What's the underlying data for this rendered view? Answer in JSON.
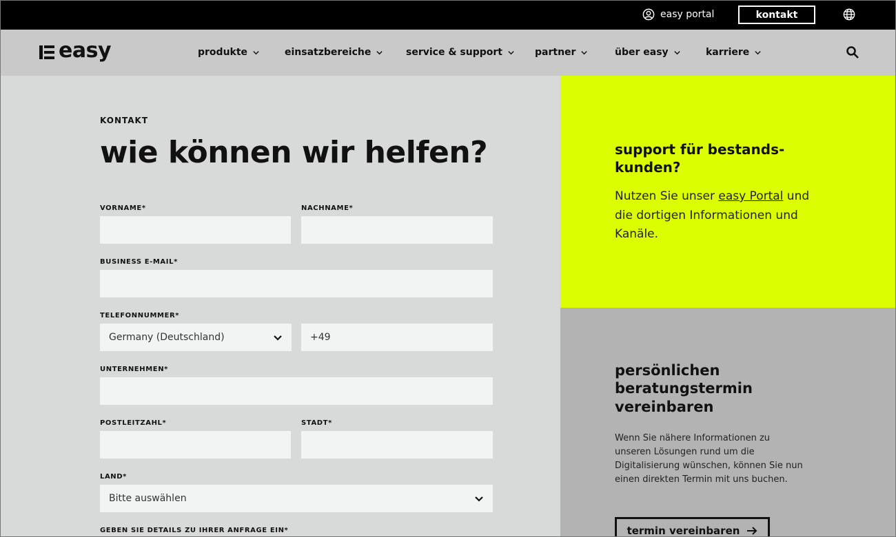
{
  "topbar": {
    "portal_label": "easy portal",
    "contact_label": "kontakt"
  },
  "nav": {
    "logo_text": "easy",
    "items": [
      {
        "label": "produkte"
      },
      {
        "label": "einsatzbereiche"
      },
      {
        "label": "service & support"
      },
      {
        "label": "partner"
      },
      {
        "label": "über easy"
      },
      {
        "label": "karriere"
      }
    ]
  },
  "form": {
    "eyebrow": "KONTAKT",
    "title": "wie können wir helfen?",
    "fields": {
      "vorname": {
        "label": "VORNAME*",
        "value": ""
      },
      "nachname": {
        "label": "NACHNAME*",
        "value": ""
      },
      "email": {
        "label": "BUSINESS E-MAIL*",
        "value": ""
      },
      "telefon": {
        "label": "TELEFONNUMMER*",
        "country": "Germany (Deutschland)",
        "value": "+49"
      },
      "unternehmen": {
        "label": "UNTERNEHMEN*",
        "value": ""
      },
      "plz": {
        "label": "POSTLEITZAHL*",
        "value": ""
      },
      "stadt": {
        "label": "STADT*",
        "value": ""
      },
      "land": {
        "label": "LAND*",
        "value": "Bitte auswählen"
      },
      "details": {
        "label": "GEBEN SIE DETAILS ZU IHRER ANFRAGE EIN*"
      }
    }
  },
  "support_panel": {
    "title": "support für bestands-kunden?",
    "body_prefix": "Nutzen Sie unser ",
    "link": "easy Portal",
    "body_suffix": " und die dortigen Informationen und Kanäle."
  },
  "termin_panel": {
    "title": "persönlichen beratungstermin vereinbaren",
    "body": "Wenn Sie nähere Informationen zu unseren Lösungen rund um die Digitalisierung wünschen, können Sie nun einen direkten Termin mit uns buchen.",
    "button_label": "termin vereinbaren"
  },
  "colors": {
    "accent_yellow": "#dcff00",
    "topbar": "#000000",
    "navbar": "#c9c9c9"
  }
}
